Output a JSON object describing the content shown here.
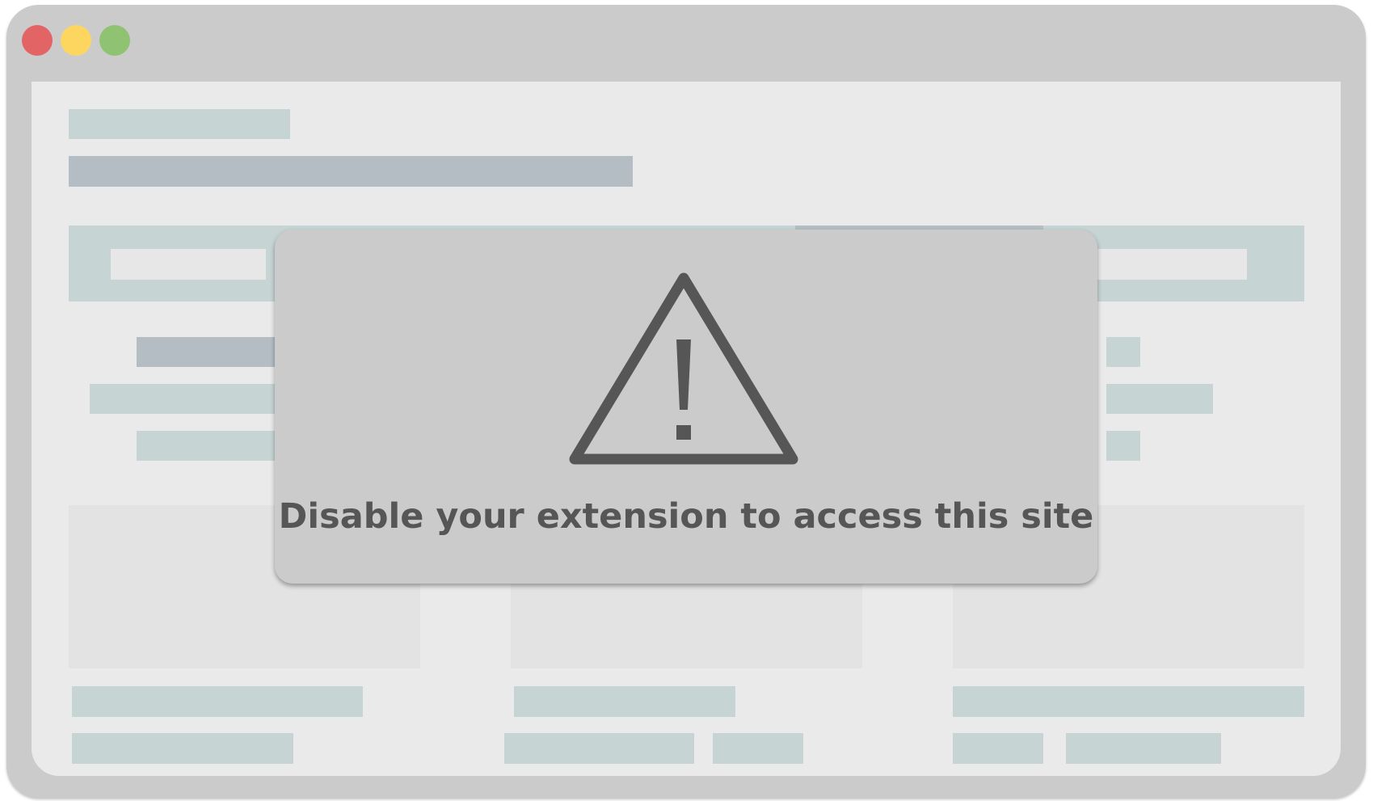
{
  "window": {
    "controls": {
      "close_color": "#e36464",
      "minimize_color": "#fcd65e",
      "maximize_color": "#8fc372"
    }
  },
  "overlay": {
    "icon": "warning-triangle-icon",
    "message": "Disable your extension to access this site",
    "text_color": "#565656"
  }
}
